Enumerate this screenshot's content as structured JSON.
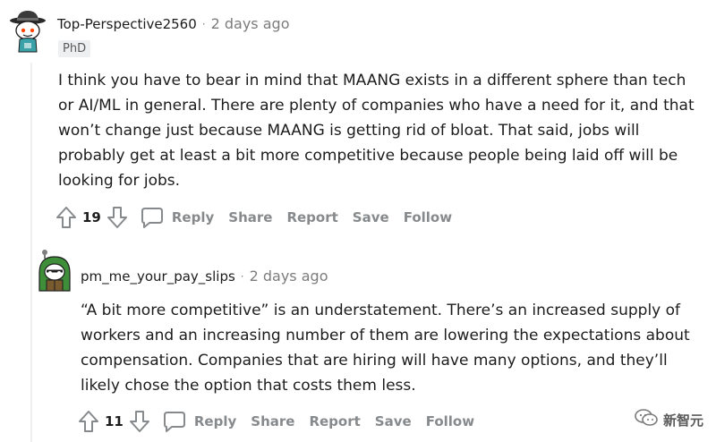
{
  "comments": [
    {
      "username": "Top-Perspective2560",
      "separator": "·",
      "time": "2 days ago",
      "flair": "PhD",
      "text": "I think you have to bear in mind that MAANG exists in a different sphere than tech or AI/ML in general. There are plenty of companies who have a need for it, and that won’t change just because MAANG is getting rid of bloat. That said, jobs will probably get at least a bit more competitive because people being laid off will be looking for jobs.",
      "votes": "19",
      "actions": {
        "reply": "Reply",
        "share": "Share",
        "report": "Report",
        "save": "Save",
        "follow": "Follow"
      }
    },
    {
      "username": "pm_me_your_pay_slips",
      "separator": "·",
      "time": "2 days ago",
      "text": "“A bit more competitive” is an understatement. There’s an increased supply of workers and an increasing number of them are lowering the expectations about compensation. Companies that are hiring will have many options, and they’ll likely chose the option that costs them less.",
      "votes": "11",
      "actions": {
        "reply": "Reply",
        "share": "Share",
        "report": "Report",
        "save": "Save",
        "follow": "Follow"
      }
    }
  ],
  "watermark": {
    "text": "新智元"
  },
  "icons": {
    "upvote": "arrow-up-icon",
    "downvote": "arrow-down-icon",
    "reply": "speech-bubble-icon",
    "watermark": "wechat-icon"
  },
  "colors": {
    "muted": "#878a8c",
    "text": "#1c1c1c",
    "thread": "#edeff1"
  }
}
